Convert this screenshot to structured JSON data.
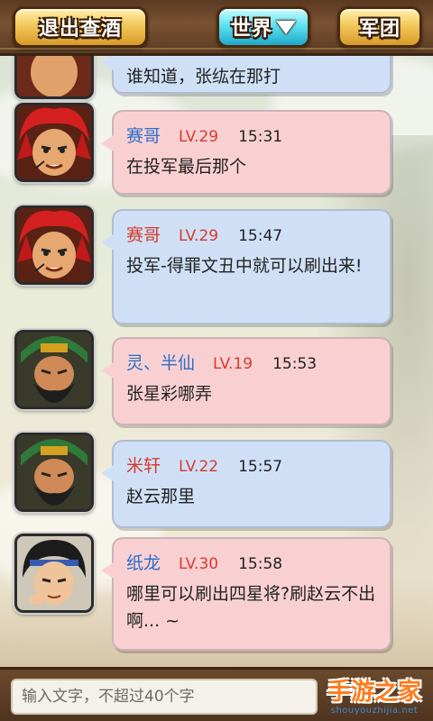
{
  "topbar": {
    "exit_label": "退出查酒",
    "world_label": "世界",
    "legion_label": "军团"
  },
  "messages": [
    {
      "name": "",
      "level": "",
      "time": "",
      "text": "谁知道，张纮在那打",
      "bubble": "blue",
      "avatar": "red-hair"
    },
    {
      "name": "赛哥",
      "level": "LV.29",
      "time": "15:31",
      "text": "在投军最后那个",
      "bubble": "pink",
      "avatar": "red-hair"
    },
    {
      "name": "赛哥",
      "level": "LV.29",
      "time": "15:47",
      "text": "投军-得罪文丑中就可以刷出来!",
      "bubble": "blue",
      "avatar": "red-hair"
    },
    {
      "name": "灵、半仙",
      "level": "LV.19",
      "time": "15:53",
      "text": "张星彩哪弄",
      "bubble": "pink",
      "avatar": "green-general"
    },
    {
      "name": "米轩",
      "level": "LV.22",
      "time": "15:57",
      "text": "赵云那里",
      "bubble": "blue",
      "avatar": "green-general"
    },
    {
      "name": "纸龙",
      "level": "LV.30",
      "time": "15:58",
      "text": "哪里可以刷出四星将?刷赵云不出啊... ~",
      "bubble": "pink",
      "avatar": "young-warrior"
    }
  ],
  "input": {
    "placeholder": "输入文字，不超过40个字"
  },
  "badge": {
    "title": "手游之家",
    "url": "shouyouzhijia.net"
  },
  "colors": {
    "pink_bubble": "#f9d0d2",
    "blue_bubble": "#cfe0f6",
    "name_blue": "#2a6fc9",
    "name_red": "#d83a2a"
  }
}
